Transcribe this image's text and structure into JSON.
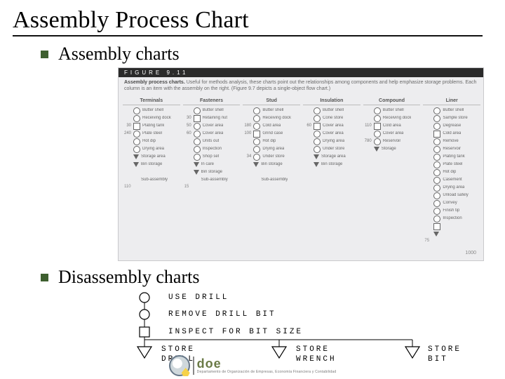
{
  "title": "Assembly Process Chart",
  "bullets": [
    "Assembly charts",
    "Disassembly charts"
  ],
  "assembly_figure": {
    "bar": "FIGURE    9.11",
    "caption_bold": "Assembly process charts.",
    "caption_rest": " Useful for methods analysis, these charts point out the relationships among components and help emphasize storage problems. Each column is an item with the assembly on the right. (Figure 9.7 depicts a single-object flow chart.)",
    "columns": [
      {
        "head": "Terminals",
        "steps": [
          {
            "n": "",
            "sym": "circle",
            "label": "Butter shell"
          },
          {
            "n": "",
            "sym": "circle",
            "label": "Receiving dock"
          },
          {
            "n": "30",
            "sym": "square",
            "label": "Plating tank"
          },
          {
            "n": "240",
            "sym": "circle",
            "label": "Plate steel"
          },
          {
            "n": "",
            "sym": "circle",
            "label": "Hot dip"
          },
          {
            "n": "",
            "sym": "circle",
            "label": "Drying area"
          },
          {
            "n": "",
            "sym": "tri",
            "label": "Storage area"
          },
          {
            "n": "",
            "sym": "tri",
            "label": "Bin storage"
          },
          {
            "n": "",
            "sym": "",
            "label": ""
          },
          {
            "n": "",
            "sym": "",
            "label": "Sub-assembly"
          }
        ],
        "foot": "110"
      },
      {
        "head": "Fasteners",
        "steps": [
          {
            "n": "",
            "sym": "circle",
            "label": "Butter shell"
          },
          {
            "n": "30",
            "sym": "square",
            "label": "Retaining nut"
          },
          {
            "n": "50",
            "sym": "circle",
            "label": "Cover area"
          },
          {
            "n": "60",
            "sym": "circle",
            "label": "Cover area"
          },
          {
            "n": "",
            "sym": "circle",
            "label": "Units out"
          },
          {
            "n": "",
            "sym": "circle",
            "label": "Inspection"
          },
          {
            "n": "",
            "sym": "circle",
            "label": "Shop set"
          },
          {
            "n": "",
            "sym": "tri",
            "label": "In care"
          },
          {
            "n": "",
            "sym": "tri",
            "label": "Bin storage"
          },
          {
            "n": "",
            "sym": "",
            "label": "Sub-assembly"
          }
        ],
        "foot": "15"
      },
      {
        "head": "Stud",
        "steps": [
          {
            "n": "",
            "sym": "circle",
            "label": "Butter shell"
          },
          {
            "n": "",
            "sym": "circle",
            "label": "Receiving dock"
          },
          {
            "n": "180",
            "sym": "circle",
            "label": "Cold area"
          },
          {
            "n": "100",
            "sym": "square",
            "label": "Grind case"
          },
          {
            "n": "",
            "sym": "circle",
            "label": "Hot dip"
          },
          {
            "n": "",
            "sym": "circle",
            "label": "Drying area"
          },
          {
            "n": "34",
            "sym": "circle",
            "label": "Under store"
          },
          {
            "n": "",
            "sym": "tri",
            "label": "Bin storage"
          },
          {
            "n": "",
            "sym": "",
            "label": ""
          },
          {
            "n": "",
            "sym": "",
            "label": "Sub-assembly"
          }
        ],
        "foot": ""
      },
      {
        "head": "Insulation",
        "steps": [
          {
            "n": "",
            "sym": "circle",
            "label": "Butter shell"
          },
          {
            "n": "",
            "sym": "circle",
            "label": "Cone store"
          },
          {
            "n": "60",
            "sym": "square",
            "label": "Cover area"
          },
          {
            "n": "",
            "sym": "circle",
            "label": "Cover area"
          },
          {
            "n": "",
            "sym": "circle",
            "label": "Drying area"
          },
          {
            "n": "",
            "sym": "circle",
            "label": "Under store"
          },
          {
            "n": "",
            "sym": "tri",
            "label": "Storage area"
          },
          {
            "n": "",
            "sym": "tri",
            "label": "Bin storage"
          },
          {
            "n": "",
            "sym": "",
            "label": ""
          },
          {
            "n": "",
            "sym": "",
            "label": ""
          }
        ],
        "foot": ""
      },
      {
        "head": "Compound",
        "steps": [
          {
            "n": "",
            "sym": "circle",
            "label": "Butter shell"
          },
          {
            "n": "",
            "sym": "circle",
            "label": "Receiving dock"
          },
          {
            "n": "110",
            "sym": "square",
            "label": "Cold area"
          },
          {
            "n": "",
            "sym": "circle",
            "label": "Cover area"
          },
          {
            "n": "780",
            "sym": "circle",
            "label": "Reservoir"
          },
          {
            "n": "",
            "sym": "tri",
            "label": "Storage"
          },
          {
            "n": "",
            "sym": "",
            "label": ""
          },
          {
            "n": "",
            "sym": "",
            "label": ""
          },
          {
            "n": "",
            "sym": "",
            "label": ""
          },
          {
            "n": "",
            "sym": "",
            "label": ""
          }
        ],
        "foot": ""
      },
      {
        "head": "Liner",
        "steps": [
          {
            "n": "",
            "sym": "circle",
            "label": "Butter shell"
          },
          {
            "n": "",
            "sym": "circle",
            "label": "Sample store"
          },
          {
            "n": "",
            "sym": "circle",
            "label": "Degrease"
          },
          {
            "n": "",
            "sym": "square",
            "label": "Cold area"
          },
          {
            "n": "",
            "sym": "circle",
            "label": "Remove"
          },
          {
            "n": "",
            "sym": "circle",
            "label": "Reservoir"
          },
          {
            "n": "",
            "sym": "circle",
            "label": "Plating tank"
          },
          {
            "n": "",
            "sym": "circle",
            "label": "Plate steel"
          },
          {
            "n": "",
            "sym": "circle",
            "label": "Hot dip"
          },
          {
            "n": "",
            "sym": "circle",
            "label": "Casement"
          },
          {
            "n": "",
            "sym": "circle",
            "label": "Drying area"
          },
          {
            "n": "",
            "sym": "circle",
            "label": "Unload safely"
          },
          {
            "n": "",
            "sym": "circle",
            "label": "Convey"
          },
          {
            "n": "",
            "sym": "circle",
            "label": "Finish tip"
          },
          {
            "n": "",
            "sym": "circle",
            "label": "Inspection"
          },
          {
            "n": "",
            "sym": "square",
            "label": ""
          },
          {
            "n": "",
            "sym": "tri",
            "label": ""
          }
        ],
        "foot": "75"
      }
    ],
    "footer_total": "1000"
  },
  "disassembly_figure": {
    "steps": [
      {
        "sym": "circle",
        "label": "USE DRILL"
      },
      {
        "sym": "circle",
        "label": "REMOVE DRILL BIT"
      },
      {
        "sym": "square",
        "label": "INSPECT FOR BIT SIZE"
      }
    ],
    "stores": [
      {
        "label1": "STORE",
        "label2": "DRILL"
      },
      {
        "label1": "STORE",
        "label2": "WRENCH"
      },
      {
        "label1": "STORE",
        "label2": "BIT"
      }
    ]
  },
  "footer_logo": {
    "main": "doe",
    "sub": "Departamento de Organización de Empresas, Economía Financiera y Contabilidad"
  }
}
